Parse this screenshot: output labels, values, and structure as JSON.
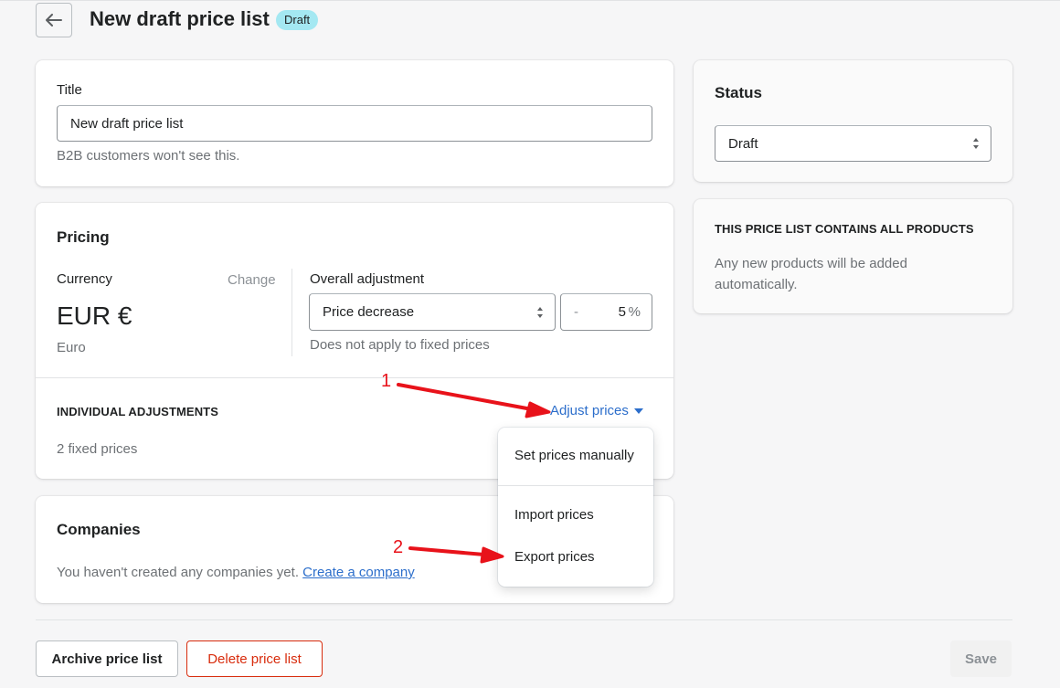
{
  "header": {
    "title": "New draft price list",
    "badge": "Draft"
  },
  "title_card": {
    "label": "Title",
    "value": "New draft price list",
    "help": "B2B customers won't see this."
  },
  "pricing": {
    "heading": "Pricing",
    "currency_label": "Currency",
    "change_link": "Change",
    "currency_code": "EUR €",
    "currency_name": "Euro",
    "adjustment_label": "Overall adjustment",
    "adjustment_type": "Price decrease",
    "adjustment_sign": "-",
    "adjustment_value": "5",
    "adjustment_unit": "%",
    "adjustment_help": "Does not apply to fixed prices",
    "individual_heading": "INDIVIDUAL ADJUSTMENTS",
    "fixed_prices": "2 fixed prices",
    "adjust_prices": "Adjust prices"
  },
  "dropdown": {
    "items": [
      "Set prices manually",
      "Import prices",
      "Export prices"
    ]
  },
  "companies": {
    "heading": "Companies",
    "text": "You haven't created any companies yet.",
    "link": "Create a company"
  },
  "status": {
    "heading": "Status",
    "value": "Draft"
  },
  "products": {
    "heading": "THIS PRICE LIST CONTAINS ALL PRODUCTS",
    "text": "Any new products will be added automatically."
  },
  "footer": {
    "archive": "Archive price list",
    "delete": "Delete price list",
    "save": "Save"
  },
  "annotations": {
    "step1": "1",
    "step2": "2",
    "color": "#e8121a"
  }
}
